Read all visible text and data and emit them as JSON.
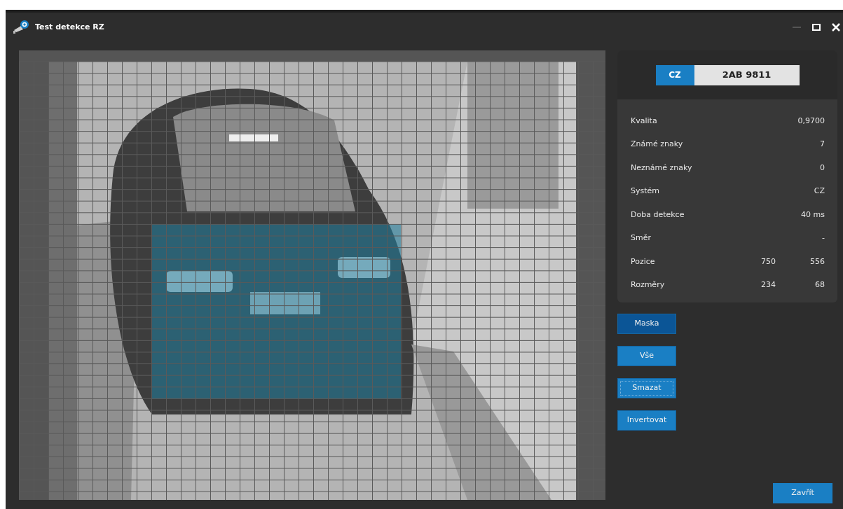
{
  "window": {
    "title": "Test detekce RZ"
  },
  "plate": {
    "country": "CZ",
    "text": "2AB 9811"
  },
  "stats": [
    {
      "label": "Kvalita",
      "values": [
        "0,9700"
      ]
    },
    {
      "label": "Známé znaky",
      "values": [
        "7"
      ]
    },
    {
      "label": "Neznámé znaky",
      "values": [
        "0"
      ]
    },
    {
      "label": "Systém",
      "values": [
        "CZ"
      ]
    },
    {
      "label": "Doba detekce",
      "values": [
        "40 ms"
      ]
    },
    {
      "label": "Směr",
      "values": [
        "-"
      ]
    },
    {
      "label": "Pozice",
      "values": [
        "750",
        "556"
      ]
    },
    {
      "label": "Rozměry",
      "values": [
        "234",
        "68"
      ]
    }
  ],
  "mask_buttons": [
    {
      "label": "Maska",
      "selected": true,
      "focused": false
    },
    {
      "label": "Vše",
      "selected": false,
      "focused": false
    },
    {
      "label": "Smazat",
      "selected": false,
      "focused": true
    },
    {
      "label": "Invertovat",
      "selected": false,
      "focused": false
    }
  ],
  "close_button": {
    "label": "Zavřít"
  }
}
